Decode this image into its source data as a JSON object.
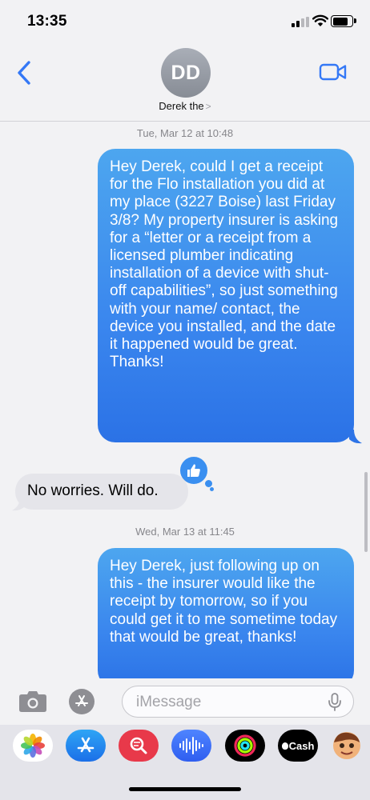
{
  "status_bar": {
    "time": "13:35"
  },
  "header": {
    "avatar_initials": "DD",
    "contact_name": "Derek the",
    "name_chevron": ">"
  },
  "conversation": {
    "timestamp_1": "Tue, Mar 12 at 10:48",
    "outgoing_1": "Hey Derek, could I get a receipt for the Flo installation you did at my place (3227 Boise) last Friday 3/8? My property insurer is asking for a “letter or a receipt from a licensed plumber indicating installation of a device with shut-off capabilities”, so just something with your name/ contact, the device you installed, and the date it happened would be great. Thanks!",
    "incoming_1": "No worries. Will do.",
    "timestamp_2": "Wed, Mar 13 at 11:45",
    "outgoing_2": "Hey Derek, just following up on this - the insurer would like the receipt by tomorrow, so if you could get it to me sometime today that would be great, thanks!"
  },
  "input_bar": {
    "placeholder": "iMessage"
  },
  "app_drawer": {
    "apps": [
      "photos-app",
      "app-store-app",
      "images-search-app",
      "audio-message-app",
      "activity-app",
      "apple-cash-app",
      "memoji-app"
    ],
    "cash_label": "Cash"
  },
  "colors": {
    "accent": "#3478f6",
    "bubble_out": "#3a86ee",
    "bubble_in": "#e5e5ea",
    "background": "#f2f2f4"
  }
}
